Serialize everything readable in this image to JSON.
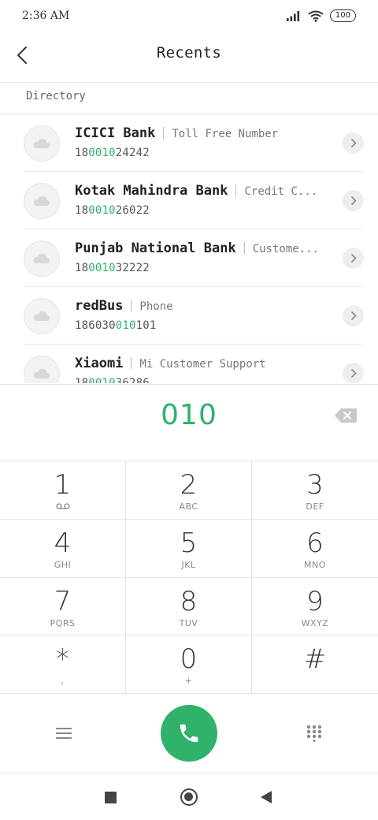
{
  "status_bar": {
    "time": "2:36 AM",
    "battery": "100"
  },
  "header": {
    "title": "Recents"
  },
  "directory": {
    "label": "Directory",
    "results": [
      {
        "name": "ICICI Bank",
        "subtitle": "Toll Free Number",
        "number_pre": "18",
        "number_mid": "0010",
        "number_post": "24242",
        "raw_number": "1800102424 2"
      },
      {
        "name": "Kotak Mahindra Bank",
        "subtitle": "Credit C...",
        "number_pre": "18",
        "number_mid": "0010",
        "number_post": "26022"
      },
      {
        "name": "Punjab National Bank",
        "subtitle": "Custome...",
        "number_pre": "18",
        "number_mid": "0010",
        "number_post": "32222"
      },
      {
        "name": "redBus",
        "subtitle": "Phone",
        "number_pre": "186030",
        "number_mid": "010",
        "number_post": "101"
      },
      {
        "name": "Xiaomi",
        "subtitle": "Mi Customer Support",
        "number_pre": "18",
        "number_mid": "0010",
        "number_post": "36286"
      }
    ]
  },
  "dialer": {
    "typed": "010"
  },
  "keypad": [
    {
      "digit": "1",
      "letters": ""
    },
    {
      "digit": "2",
      "letters": "ABC"
    },
    {
      "digit": "3",
      "letters": "DEF"
    },
    {
      "digit": "4",
      "letters": "GHI"
    },
    {
      "digit": "5",
      "letters": "JKL"
    },
    {
      "digit": "6",
      "letters": "MNO"
    },
    {
      "digit": "7",
      "letters": "PQRS"
    },
    {
      "digit": "8",
      "letters": "TUV"
    },
    {
      "digit": "9",
      "letters": "WXYZ"
    },
    {
      "digit": "*",
      "letters": ","
    },
    {
      "digit": "0",
      "letters": "+"
    },
    {
      "digit": "#",
      "letters": ""
    }
  ],
  "colors": {
    "accent": "#2fb26a",
    "text": "#222222",
    "muted": "#888888"
  },
  "icons": {
    "back": "chevron-left-icon",
    "avatar": "cloud-icon",
    "row_action": "chevron-right-icon",
    "backspace": "backspace-icon",
    "voicemail": "voicemail-icon",
    "menu": "menu-icon",
    "call": "phone-icon",
    "dialpad": "dialpad-icon"
  }
}
